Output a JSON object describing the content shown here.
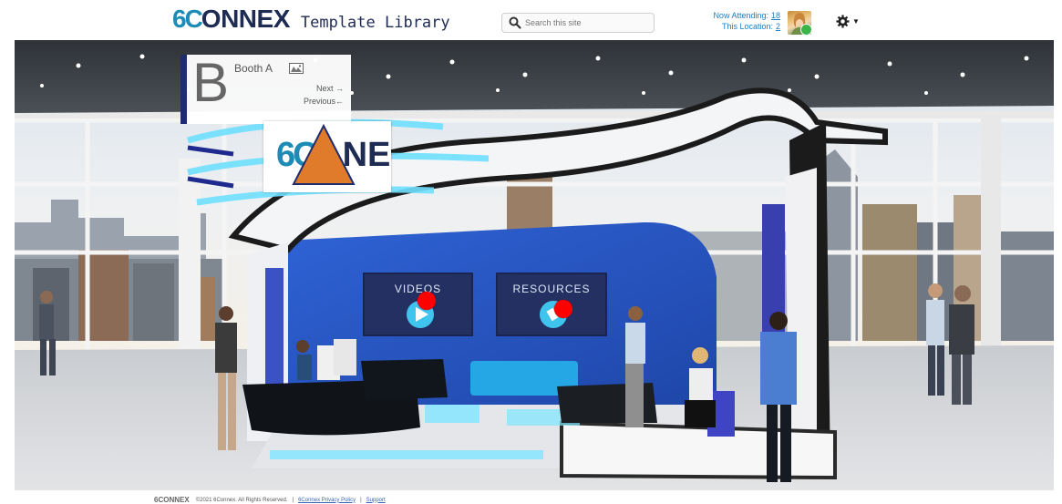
{
  "header": {
    "logo_6c": "6C",
    "logo_onnex": "ONNEX",
    "logo_subtitle": "Template Library",
    "search_placeholder": "Search this site",
    "now_attending_label": "Now Attending:",
    "now_attending_count": "18",
    "this_location_label": "This Location:",
    "this_location_count": "2"
  },
  "booth_nav": {
    "letter": "B",
    "name": "Booth A",
    "next_label": "Next →",
    "previous_label": "Previous←"
  },
  "sign": {
    "brand_6c": "6C",
    "brand_onnex": "NEX"
  },
  "screens": {
    "videos_label": "VIDEOS",
    "resources_label": "RESOURCES"
  },
  "footer": {
    "logo": "6CONNEX",
    "copyright": "©2021 6Connex. All Rights Reserved.",
    "sep1": "|",
    "privacy_link": "6Connex Privacy Policy",
    "sep2": "|",
    "support_link": "Support"
  },
  "colors": {
    "brand_teal": "#1c8bb6",
    "brand_navy": "#1e2b53",
    "link_blue": "#1a7fc6",
    "hotspot_red": "#ff0000",
    "marker_orange": "#e07b2b",
    "booth_blue": "#2a58c9"
  },
  "icons": [
    "search-icon",
    "user-avatar",
    "gear-icon",
    "map-icon",
    "play-icon",
    "download-icon",
    "hotspot-marker",
    "orange-triangle-marker"
  ]
}
